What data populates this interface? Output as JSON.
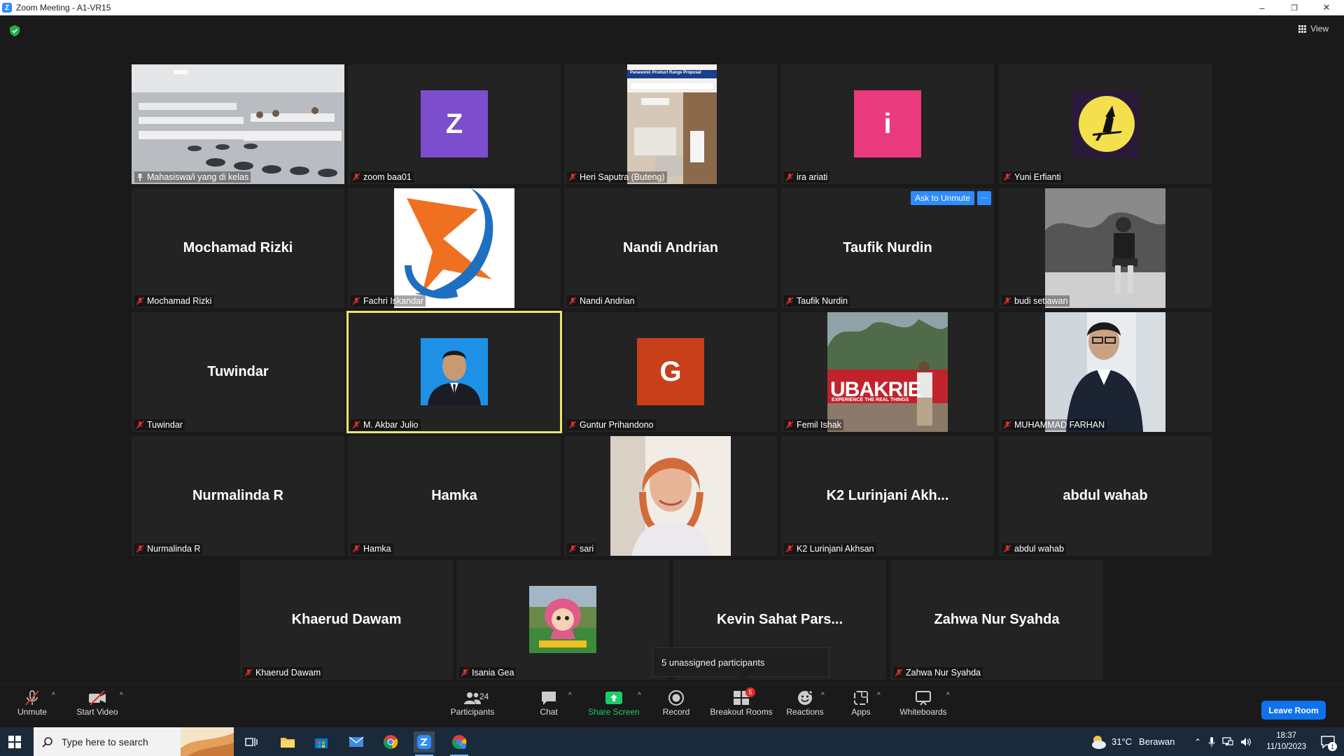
{
  "window": {
    "title": "Zoom Meeting - A1-VR15",
    "min": "–",
    "restore": "❐",
    "close": "✕"
  },
  "view": {
    "label": "View"
  },
  "tiles": [
    {
      "name": "Mahasiswa/i yang di kelas"
    },
    {
      "name": "zoom baa01",
      "letter": "Z",
      "color": "#7c4dcc"
    },
    {
      "name": "Heri Saputra (Buteng)",
      "slide_title": "Panasonic Product Range Proposal"
    },
    {
      "name": "ira ariati",
      "letter": "i",
      "color": "#e83a7c"
    },
    {
      "name": "Yuni Erfianti"
    },
    {
      "name": "Mochamad Rizki",
      "display": "Mochamad Rizki"
    },
    {
      "name": "Fachri Iskandar"
    },
    {
      "name": "Nandi Andrian",
      "display": "Nandi Andrian"
    },
    {
      "name": "Taufik Nurdin",
      "display": "Taufik Nurdin",
      "ask_label": "Ask to Unmute",
      "more_label": "···"
    },
    {
      "name": "budi setiawan"
    },
    {
      "name": "Tuwindar",
      "display": "Tuwindar"
    },
    {
      "name": "M. Akbar Julio"
    },
    {
      "name": "Guntur Prihandono",
      "letter": "G",
      "color": "#c7401a"
    },
    {
      "name": "Femil Ishak",
      "banner": "UBAKRIE",
      "banner_sub": "EXPERIENCE THE REAL THINGS"
    },
    {
      "name": "MUHAMMAD FARHAN"
    },
    {
      "name": "Nurmalinda R",
      "display": "Nurmalinda R"
    },
    {
      "name": "Hamka",
      "display": "Hamka"
    },
    {
      "name": "sari"
    },
    {
      "name": "K2 Lurinjani Akhsan",
      "display": "K2  Lurinjani  Akh..."
    },
    {
      "name": "abdul wahab",
      "display": "abdul wahab"
    },
    {
      "name": "Khaerud Dawam",
      "display": "Khaerud Dawam"
    },
    {
      "name": "Isania Gea"
    },
    {
      "name": "Kevin Sahat Parsaoran",
      "display": "Kevin  Sahat  Pars..."
    },
    {
      "name": "Zahwa Nur Syahda",
      "display": "Zahwa Nur Syahda"
    }
  ],
  "tooltip": "5 unassigned participants",
  "toolbar": {
    "unmute": "Unmute",
    "start_video": "Start Video",
    "participants": "Participants",
    "participants_count": "24",
    "chat": "Chat",
    "share_screen": "Share Screen",
    "record": "Record",
    "breakout_rooms": "Breakout Rooms",
    "breakout_count": "5",
    "reactions": "Reactions",
    "apps": "Apps",
    "whiteboards": "Whiteboards",
    "leave": "Leave Room"
  },
  "taskbar": {
    "search_placeholder": "Type here to search",
    "weather_temp": "31°C",
    "weather_text": "Berawan",
    "time": "18:37",
    "date": "11/10/2023",
    "notif_count": "1"
  }
}
